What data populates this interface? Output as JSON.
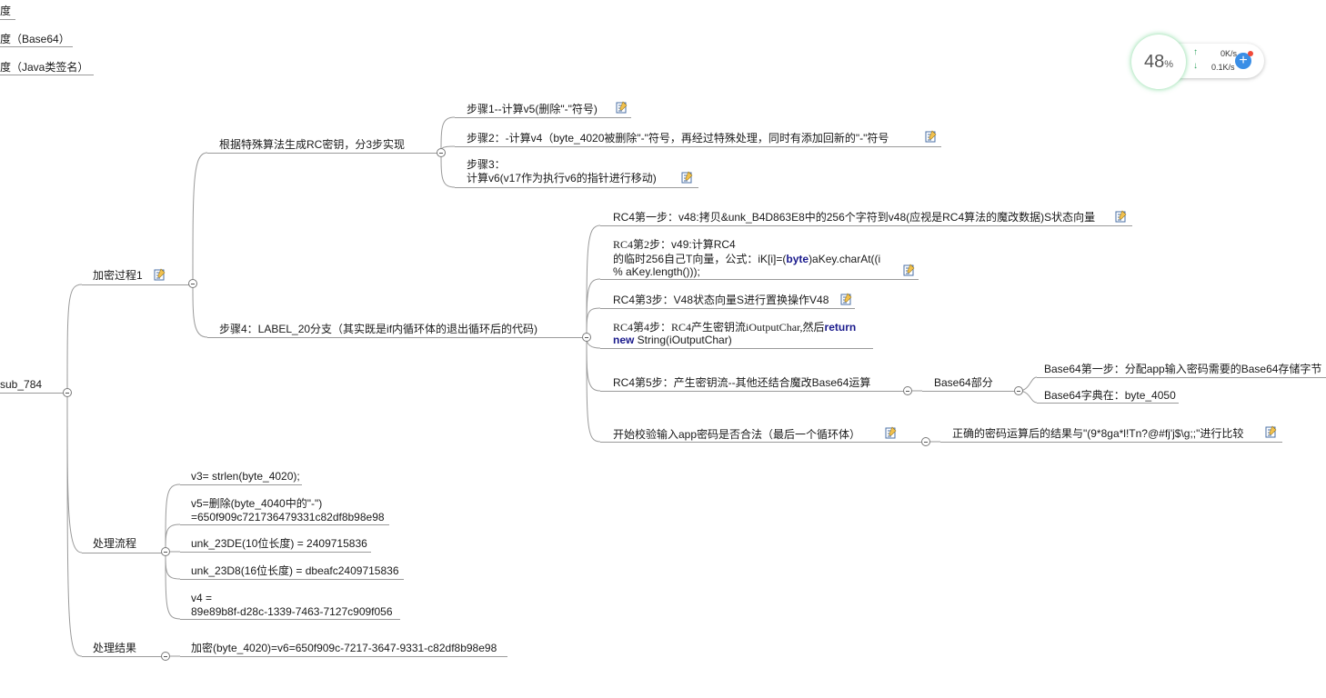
{
  "legend": {
    "item1": "度",
    "item2": "度（Base64）",
    "item3": "度（Java类签名）"
  },
  "root": {
    "label": "sub_784"
  },
  "branches": {
    "enc": {
      "label": "加密过程1",
      "gen_key": {
        "label": "根据特殊算法生成RC密钥，分3步实现",
        "step1": "步骤1--计算v5(删除\"-\"符号)",
        "step2": "步骤2：-计算v4（byte_4020被删除\"-\"符号，再经过特殊处理，同时有添加回新的\"-\"符号",
        "step3": "步骤3：\n计算v6(v17作为执行v6的指针进行移动)"
      },
      "step4": {
        "label": "步骤4：LABEL_20分支（其实既是if内循环体的退出循环后的代码)",
        "rc4_1": "RC4第一步：v48:拷贝&unk_B4D863E8中的256个字符到v48(应视是RC4算法的魔改数据)S状态向量",
        "rc4_2a": "RC4第2步：",
        "rc4_2b": "v49:计算RC4",
        "rc4_2c": "的临时256自己T向量，公式：iK[i]=(",
        "rc4_2kw": "byte",
        "rc4_2d": ")aKey.charAt((i",
        "rc4_2e": "% aKey.length()));",
        "rc4_3": "RC4第3步：V48状态向量S进行置换操作V48",
        "rc4_4a": "RC4第4步：RC4产生密钥流iOutputChar,然后",
        "rc4_4kw1": "return",
        "rc4_4kw2": "new",
        "rc4_4b": " String(iOutputChar)",
        "rc4_5": "RC4第5步：产生密钥流--其他还结合魔改Base64运算",
        "base64": {
          "label": "Base64部分",
          "b1": "Base64第一步：分配app输入密码需要的Base64存储字节",
          "b2": "Base64字典在：byte_4050"
        },
        "verify": "开始校验输入app密码是否合法（最后一个循环体）",
        "verify_result": "正确的密码运算后的结果与\"(9*8ga*l!Tn?@#fj'j$\\g;;\"进行比较"
      }
    },
    "flow": {
      "label": "处理流程",
      "f1": "v3= strlen(byte_4020);",
      "f2": "v5=删除(byte_4040中的\"-\")\n=650f909c721736479331c82df8b98e98",
      "f3": "unk_23DE(10位长度) = 2409715836",
      "f4": "unk_23D8(16位长度) = dbeafc2409715836",
      "f5": "v4 =\n89e89b8f-d28c-1339-7463-7127c909f056"
    },
    "result": {
      "label": "处理结果",
      "r1": "加密(byte_4020)=v6=650f909c-7217-3647-9331-c82df8b98e98"
    }
  },
  "widget": {
    "percent": "48",
    "percent_sign": "%",
    "up_speed": "0K/s",
    "down_speed": "0.1K/s",
    "up_arrow": "↑",
    "down_arrow": "↓",
    "plus": "+"
  },
  "colors": {
    "edge": "#9a9a9a",
    "accent": "#46c86e",
    "keyword": "#1a1a8c"
  }
}
